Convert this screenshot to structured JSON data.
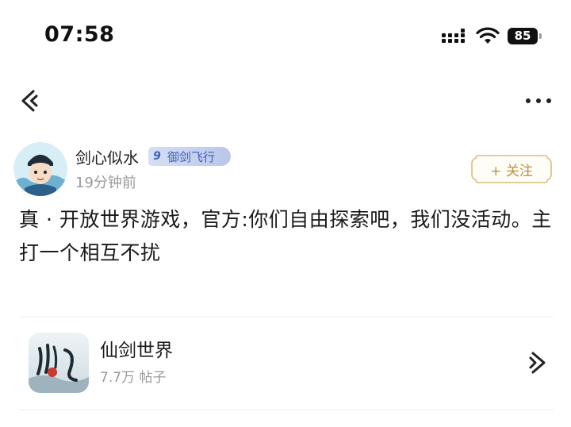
{
  "status_bar": {
    "time": "07:58",
    "battery": "85"
  },
  "nav": {
    "back_icon": "back-arrow-icon",
    "more_icon": "more-dots-icon"
  },
  "author": {
    "name": "剑心似水",
    "level": "9",
    "level_title": "御剑飞行",
    "time_ago": "19分钟前",
    "follow_label": "+ 关注"
  },
  "post": {
    "text": "真 · 开放世界游戏，官方:你们自由探索吧，我们没活动。主打一个相互不扰"
  },
  "forum": {
    "name": "仙剑世界",
    "post_count": "7.7万 帖子"
  },
  "colors": {
    "accent_gold": "#b8913f",
    "badge_blue": "#3f5fb8"
  }
}
